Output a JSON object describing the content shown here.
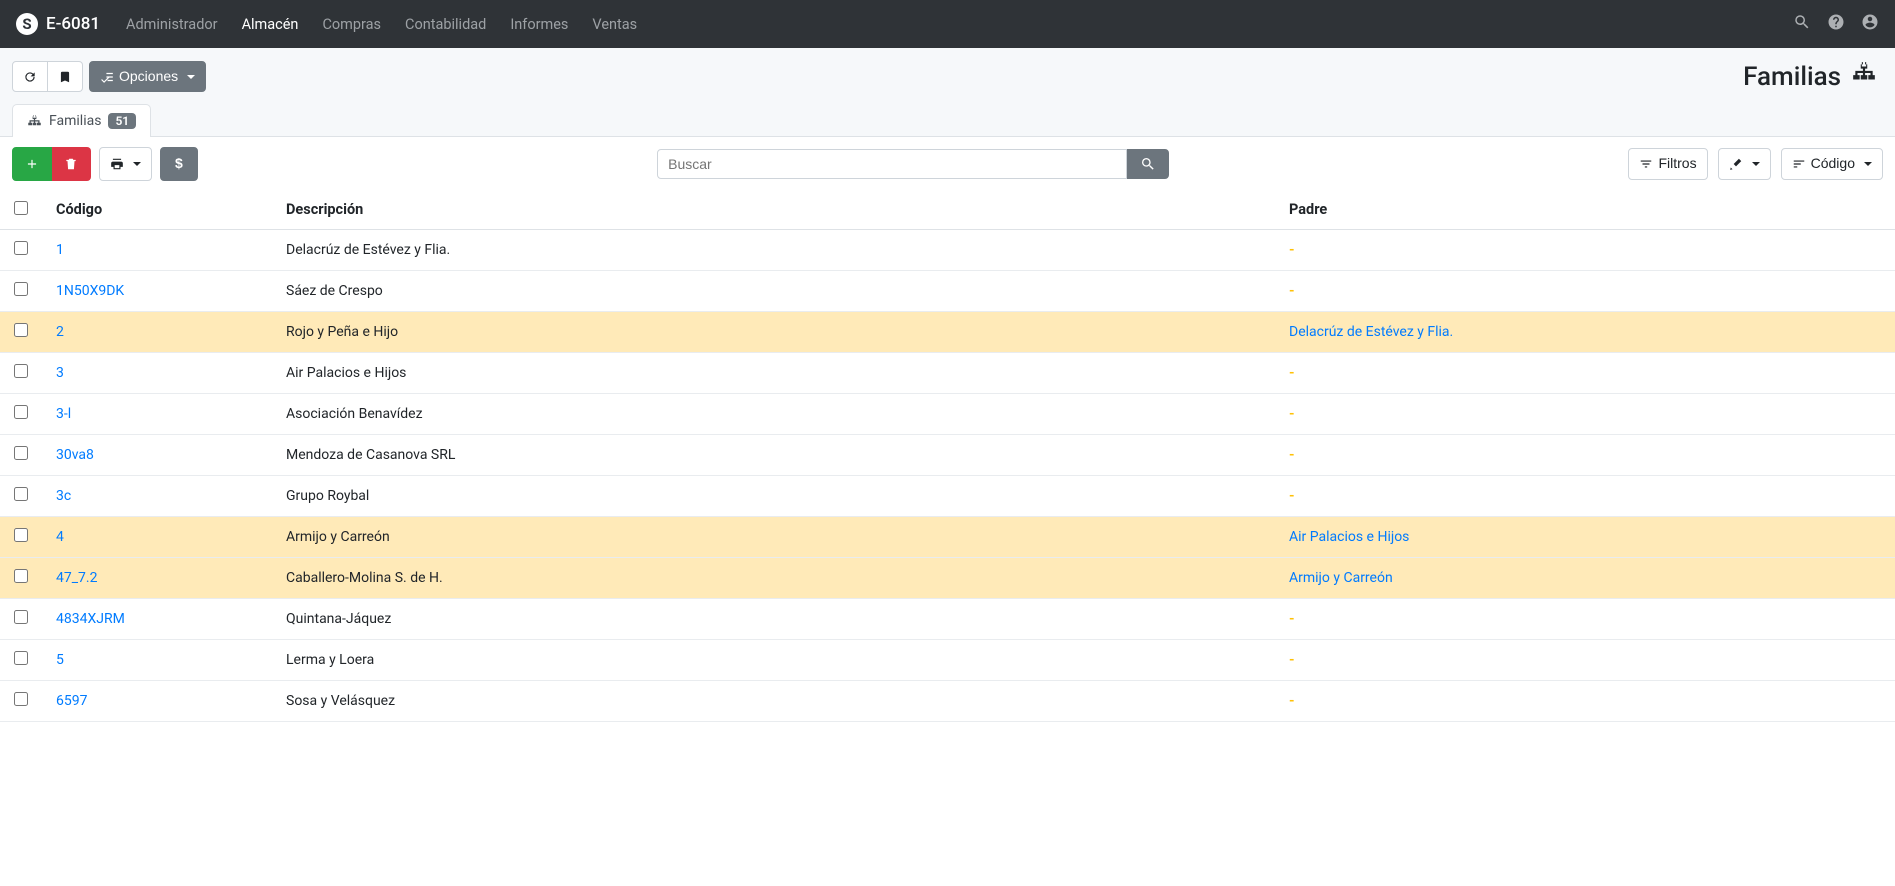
{
  "brand": "E-6081",
  "nav": {
    "items": [
      "Administrador",
      "Almacén",
      "Compras",
      "Contabilidad",
      "Informes",
      "Ventas"
    ],
    "active_index": 1
  },
  "options_btn": "Opciones",
  "page_title": "Familias",
  "tab": {
    "label": "Familias",
    "count": "51"
  },
  "search": {
    "placeholder": "Buscar"
  },
  "filters_btn": "Filtros",
  "sort_btn": "Código",
  "dollar_btn": "$",
  "table": {
    "headers": {
      "codigo": "Código",
      "descripcion": "Descripción",
      "padre": "Padre"
    },
    "rows": [
      {
        "codigo": "1",
        "descripcion": "Delacrúz de Estévez y Flia.",
        "padre": null,
        "highlight": false
      },
      {
        "codigo": "1N50X9DK",
        "descripcion": "Sáez de Crespo",
        "padre": null,
        "highlight": false
      },
      {
        "codigo": "2",
        "descripcion": "Rojo y Peña e Hijo",
        "padre": "Delacrúz de Estévez y Flia.",
        "highlight": true
      },
      {
        "codigo": "3",
        "descripcion": "Air Palacios e Hijos",
        "padre": null,
        "highlight": false
      },
      {
        "codigo": "3-l",
        "descripcion": "Asociación Benavídez",
        "padre": null,
        "highlight": false
      },
      {
        "codigo": "30va8",
        "descripcion": "Mendoza de Casanova SRL",
        "padre": null,
        "highlight": false
      },
      {
        "codigo": "3c",
        "descripcion": "Grupo Roybal",
        "padre": null,
        "highlight": false
      },
      {
        "codigo": "4",
        "descripcion": "Armijo y Carreón",
        "padre": "Air Palacios e Hijos",
        "highlight": true
      },
      {
        "codigo": "47_7.2",
        "descripcion": "Caballero-Molina S. de H.",
        "padre": "Armijo y Carreón",
        "highlight": true
      },
      {
        "codigo": "4834XJRM",
        "descripcion": "Quintana-Jáquez",
        "padre": null,
        "highlight": false
      },
      {
        "codigo": "5",
        "descripcion": "Lerma y Loera",
        "padre": null,
        "highlight": false
      },
      {
        "codigo": "6597",
        "descripcion": "Sosa y Velásquez",
        "padre": null,
        "highlight": false
      }
    ]
  }
}
